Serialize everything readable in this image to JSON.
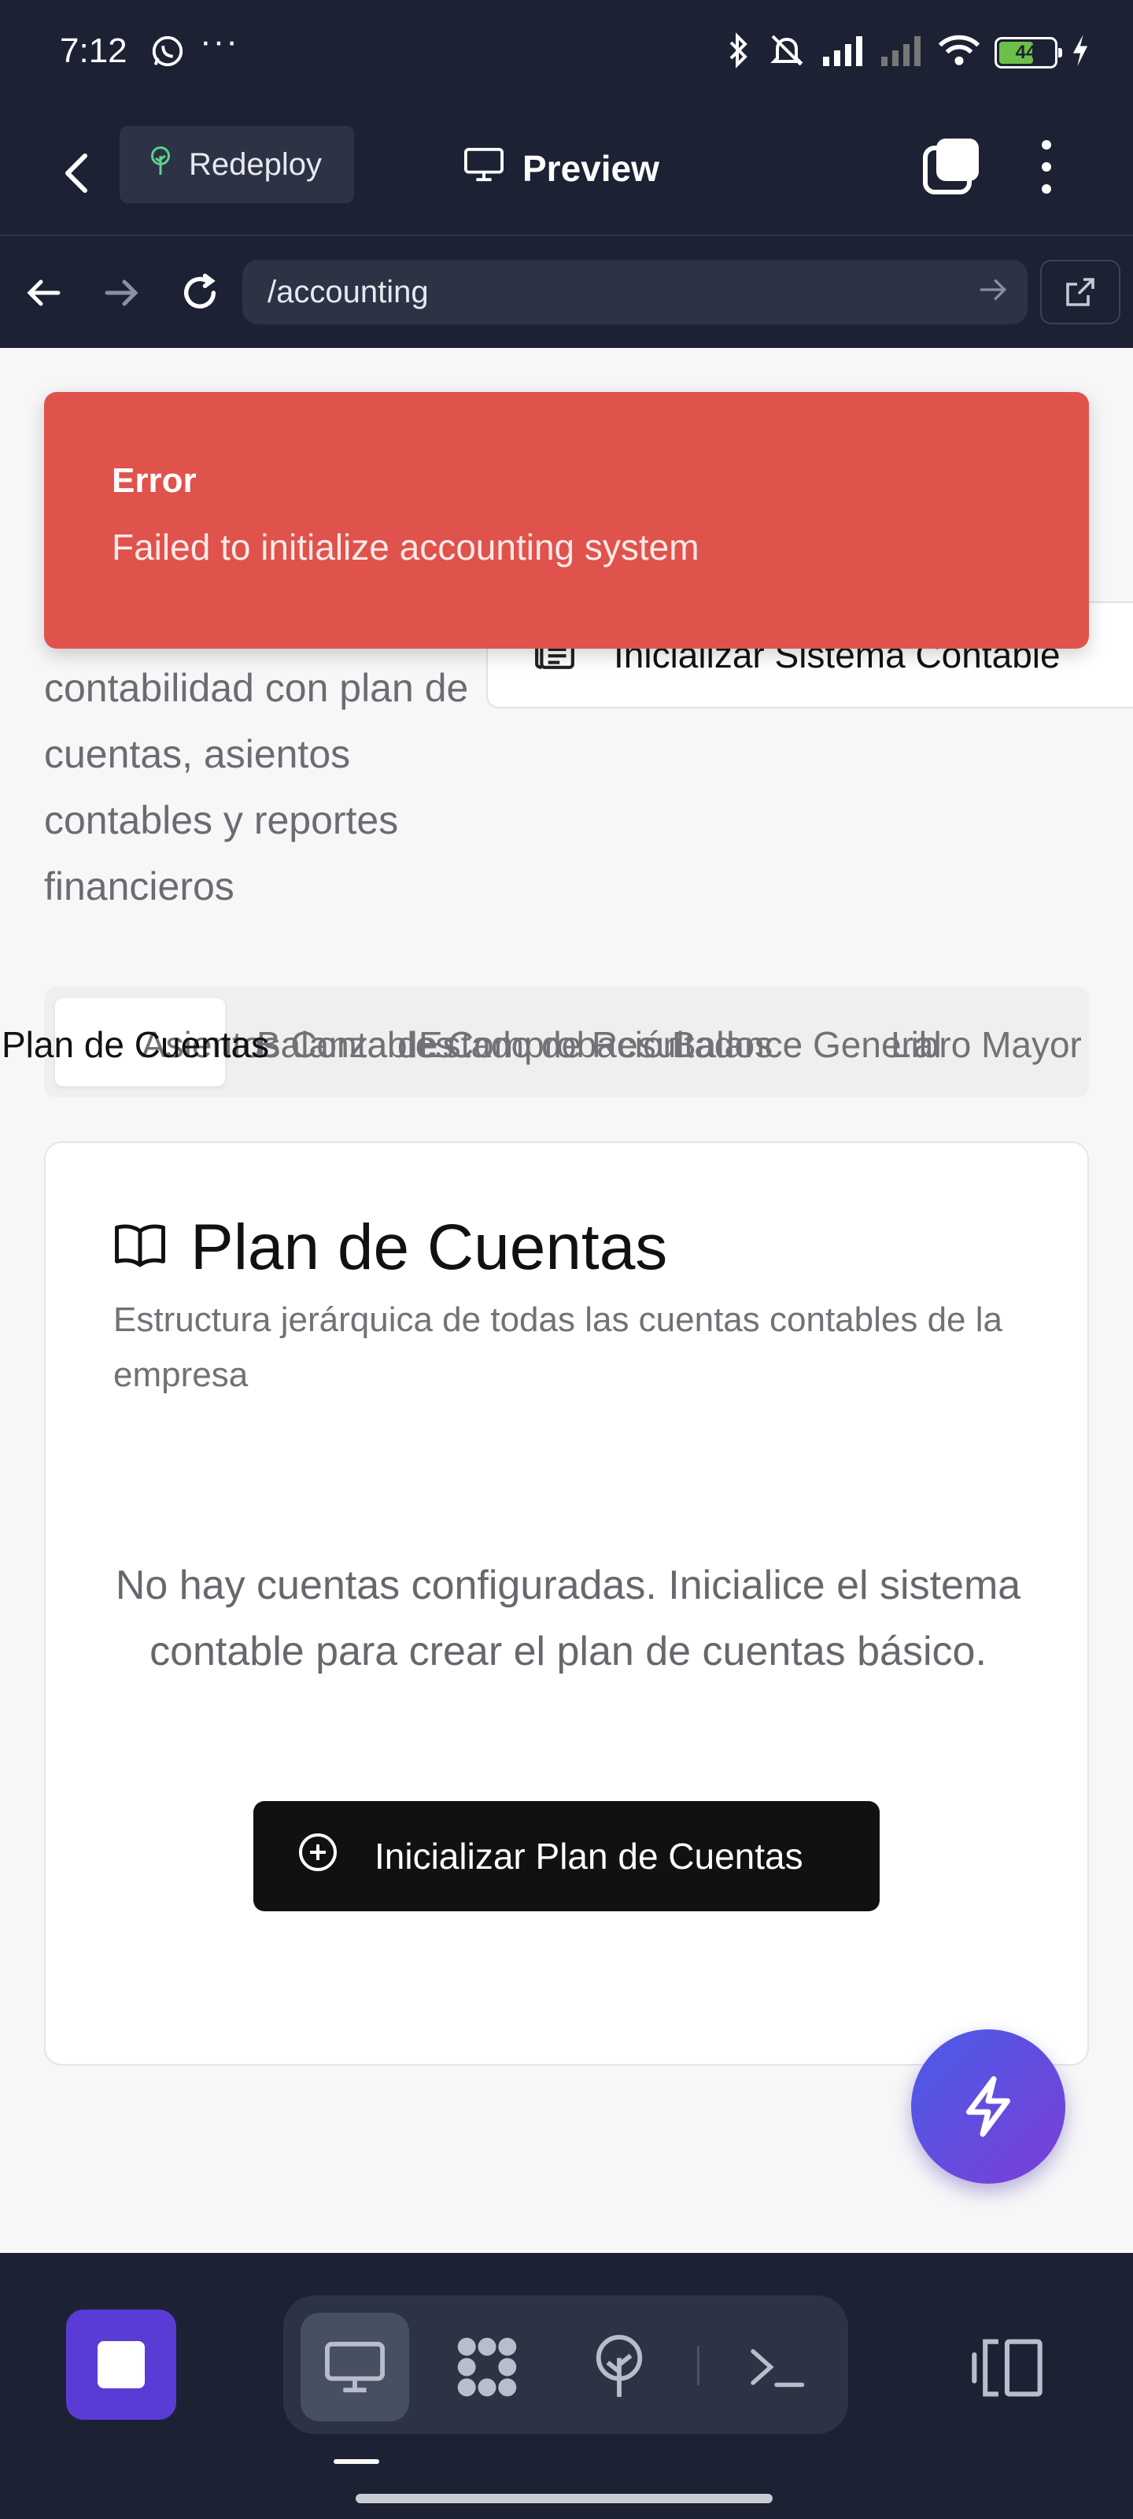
{
  "status_bar": {
    "time": "7:12",
    "dots": "···",
    "battery": "44"
  },
  "header": {
    "redeploy_label": "Redeploy",
    "title": "Preview"
  },
  "url_bar": {
    "url": "/accounting"
  },
  "toast": {
    "title": "Error",
    "message": "Failed to initialize accounting system"
  },
  "page": {
    "description": "contabilidad con plan de cuentas, asientos contables y reportes financieros",
    "init_system_label": "Inicializar Sistema Contable"
  },
  "tabs": [
    {
      "label": "Plan de Cuentas",
      "active": true
    },
    {
      "label": "Asientos Contables",
      "active": false
    },
    {
      "label": "Balanza de Comprobación",
      "active": false
    },
    {
      "label": "Estado de Resultados",
      "active": false
    },
    {
      "label": "Balance General",
      "active": false
    },
    {
      "label": "Libro Mayor",
      "active": false
    }
  ],
  "card": {
    "title": "Plan de Cuentas",
    "subtitle": "Estructura jerárquica de todas las cuentas contables de la empresa",
    "empty_message": "No hay cuentas configuradas. Inicialice el sistema contable para crear el plan de cuentas básico.",
    "button_label": "Inicializar Plan de Cuentas"
  },
  "bottom_bar": {
    "tools": [
      "monitor-icon",
      "apps-grid-icon",
      "deploy-tree-icon",
      "terminal-icon"
    ]
  },
  "colors": {
    "toast_bg": "#e0524c",
    "stop_button": "#5b3bd6",
    "fab_gradient_start": "#4a5ce8",
    "fab_gradient_end": "#7b3ed6",
    "chrome_bg": "#1c2233"
  }
}
